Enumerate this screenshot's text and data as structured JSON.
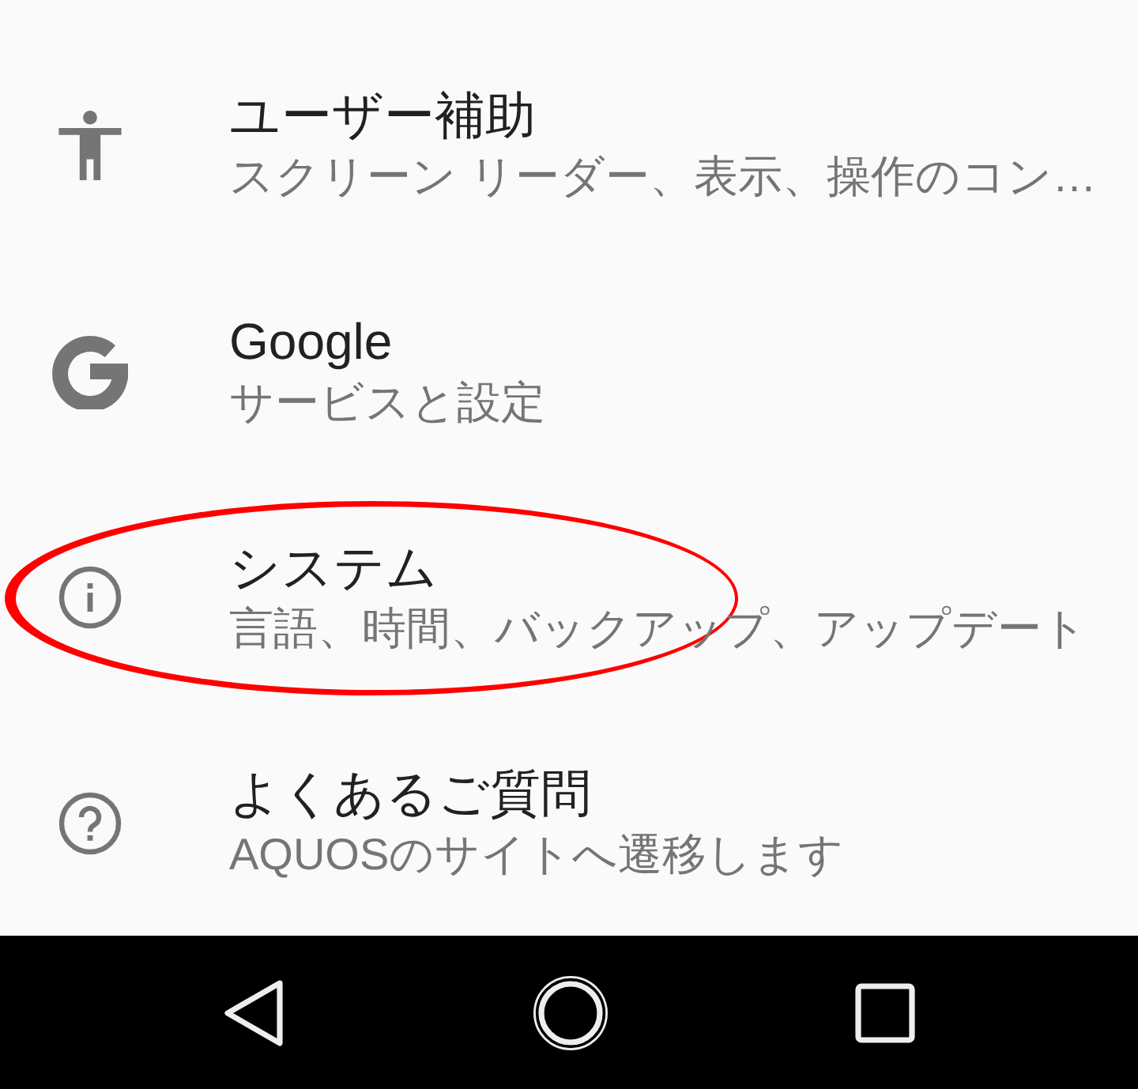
{
  "settings": [
    {
      "kind": "accessibility",
      "title": "ユーザー補助",
      "summary": "スクリーン リーダー、表示、操作のコン…",
      "highlighted": false
    },
    {
      "kind": "google",
      "title": "Google",
      "summary": "サービスと設定",
      "highlighted": false
    },
    {
      "kind": "system",
      "title": "システム",
      "summary": "言語、時間、バックアップ、アップデート",
      "highlighted": true
    },
    {
      "kind": "help",
      "title": "よくあるご質問",
      "summary": "AQUOSのサイトへ遷移します",
      "highlighted": false
    }
  ],
  "nav_bar": {
    "buttons": [
      {
        "kind": "back"
      },
      {
        "kind": "home"
      },
      {
        "kind": "recents"
      }
    ]
  }
}
